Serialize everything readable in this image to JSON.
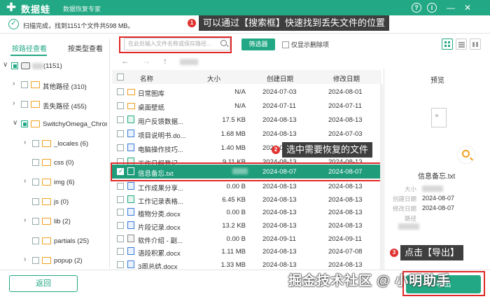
{
  "app": {
    "title": "数据蛙",
    "subtitle": "数据恢复专家"
  },
  "window": {
    "help": "?",
    "info": "i",
    "minimize": "—",
    "close": "✕"
  },
  "status": {
    "text": "扫描完成，找到1151个文件共598 MB。"
  },
  "annotations": {
    "callout1": {
      "num": "1",
      "text": "可以通过【搜索框】快速找到丢失文件的位置"
    },
    "callout2": {
      "num": "2",
      "text": "选中需要恢复的文件"
    },
    "callout3": {
      "num": "3",
      "text": "点击【导出】"
    }
  },
  "sidebar": {
    "tabs": [
      {
        "label": "按路径查看",
        "active": true
      },
      {
        "label": "按类型查看",
        "active": false
      }
    ],
    "root": {
      "label": "(1151)"
    },
    "items": [
      {
        "label": "其他路径 (310)"
      },
      {
        "label": "丢失路径 (455)"
      },
      {
        "label": "SwitchyOmega_Chrom"
      },
      {
        "label": "_locales (6)"
      },
      {
        "label": "css (0)"
      },
      {
        "label": "img (6)"
      },
      {
        "label": "js (0)"
      },
      {
        "label": "lib (2)"
      },
      {
        "label": "partials (25)"
      },
      {
        "label": "popup (2)"
      }
    ]
  },
  "toolbar": {
    "search_placeholder": "在此处输入文件名称或保存路径...",
    "filter_label": "筛选器",
    "only_deleted_label": "仅显示删除项"
  },
  "nav": {
    "back": "←",
    "forward": "→",
    "up": "↑"
  },
  "table": {
    "columns": {
      "name": "名称",
      "size": "大小",
      "created": "创建日期",
      "modified": "修改日期"
    },
    "rows": [
      {
        "name": "日常图库",
        "size": "N/A",
        "created": "2024-07-03",
        "modified": "2024-08-01",
        "type": "folder"
      },
      {
        "name": "桌面壁纸",
        "size": "N/A",
        "created": "2024-07-11",
        "modified": "2024-07-11",
        "type": "folder"
      },
      {
        "name": "用户反馈数据...",
        "size": "17.5 KB",
        "created": "2024-08-13",
        "modified": "2024-08-13",
        "type": "xls"
      },
      {
        "name": "项目说明书.do...",
        "size": "1.68 MB",
        "created": "2024-08-13",
        "modified": "2024-07-03",
        "type": "doc"
      },
      {
        "name": "电脑操作技巧...",
        "size": "1.40 MB",
        "created": "2024-08-13",
        "modified": "2024-08-05",
        "type": "doc"
      },
      {
        "name": "工作日报登记...",
        "size": "9.11 KB",
        "created": "2024-08-13",
        "modified": "2024-08-13",
        "type": "xls"
      },
      {
        "name": "信息备忘.txt",
        "size": "",
        "created": "2024-08-07",
        "modified": "2024-08-07",
        "type": "txt",
        "selected": true
      },
      {
        "name": "工作成果分享...",
        "size": "0.00 B",
        "created": "2024-08-13",
        "modified": "2024-08-13",
        "type": "doc"
      },
      {
        "name": "工作记录表格...",
        "size": "6.45 KB",
        "created": "2024-08-13",
        "modified": "2024-08-13",
        "type": "xls"
      },
      {
        "name": "植物分类.docx",
        "size": "0.00 B",
        "created": "2024-08-13",
        "modified": "2024-08-13",
        "type": "doc"
      },
      {
        "name": "片段记录.docx",
        "size": "13.2 KB",
        "created": "2024-08-13",
        "modified": "2024-08-13",
        "type": "doc"
      },
      {
        "name": "软件介绍 - 副...",
        "size": "0.00 B",
        "created": "2024-09-11",
        "modified": "2024-09-11",
        "type": "doc"
      },
      {
        "name": "语段积累.docx",
        "size": "1.11 MB",
        "created": "2024-08-13",
        "modified": "2024-07-08",
        "type": "doc"
      },
      {
        "name": "3周总结.docx",
        "size": "1.33 MB",
        "created": "2024-08-13",
        "modified": "2024-08-13",
        "type": "doc"
      }
    ]
  },
  "preview": {
    "title": "预览",
    "filename": "信息备忘.txt",
    "info": [
      {
        "label": "大小",
        "value": ""
      },
      {
        "label": "创建日期",
        "value": "2024-08-07"
      },
      {
        "label": "修改日期",
        "value": "2024-08-07"
      },
      {
        "label": "路径",
        "value": ""
      }
    ]
  },
  "footer": {
    "back_label": "返回",
    "export_label": "导出"
  },
  "watermark": "掘金技术社区 @ 小明助手",
  "colors": {
    "accent": "#22a884",
    "selected_row": "#1f9c7a",
    "annotation_red": "#e02828",
    "callout_bg": "#3e3e3e"
  }
}
